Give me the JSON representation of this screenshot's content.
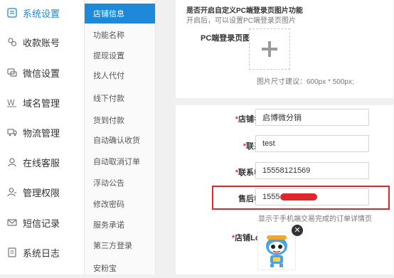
{
  "nav": {
    "items": [
      {
        "label": "系统设置",
        "icon": "settings-icon"
      },
      {
        "label": "收款账号",
        "icon": "account-icon"
      },
      {
        "label": "微信设置",
        "icon": "wechat-icon"
      },
      {
        "label": "域名管理",
        "icon": "domain-icon"
      },
      {
        "label": "物流管理",
        "icon": "truck-icon"
      },
      {
        "label": "在线客服",
        "icon": "customer-service-icon"
      },
      {
        "label": "管理权限",
        "icon": "user-permission-icon"
      },
      {
        "label": "短信记录",
        "icon": "sms-icon"
      },
      {
        "label": "系统日志",
        "icon": "log-icon"
      }
    ]
  },
  "subnav": {
    "items": [
      {
        "label": "店铺信息"
      },
      {
        "label": "功能名称"
      },
      {
        "label": "提现设置"
      },
      {
        "label": "找人代付"
      },
      {
        "label": "线下付款"
      },
      {
        "label": "货到付款"
      },
      {
        "label": "自动确认收货"
      },
      {
        "label": "自动取消订单"
      },
      {
        "label": "浮动公告"
      },
      {
        "label": "修改密码"
      },
      {
        "label": "服务承诺"
      },
      {
        "label": "第三方登录"
      },
      {
        "label": "安粉宝"
      }
    ]
  },
  "pc_login": {
    "heading": "是否开启自定义PC端登录页图片功能",
    "hint": "开启后，可以设置PC端登录页图片",
    "image_label": "PC端登录页图片：",
    "size_hint": "图片尺寸建议：600px * 500px;"
  },
  "form": {
    "shop_name": {
      "label": "店铺名称：",
      "value": "启博微分销"
    },
    "contact": {
      "label": "联系人：",
      "value": "test"
    },
    "phone": {
      "label": "联系电话：",
      "value": "15558121569"
    },
    "after_sale_phone": {
      "label": "售后电话：",
      "value": "1555"
    },
    "after_sale_hint": "显示于手机端交易完成的订单详情页",
    "logo_label": "店铺Logo："
  },
  "colors": {
    "accent": "#1e88d9",
    "highlight": "#e0262d",
    "required": "#e4393c"
  }
}
